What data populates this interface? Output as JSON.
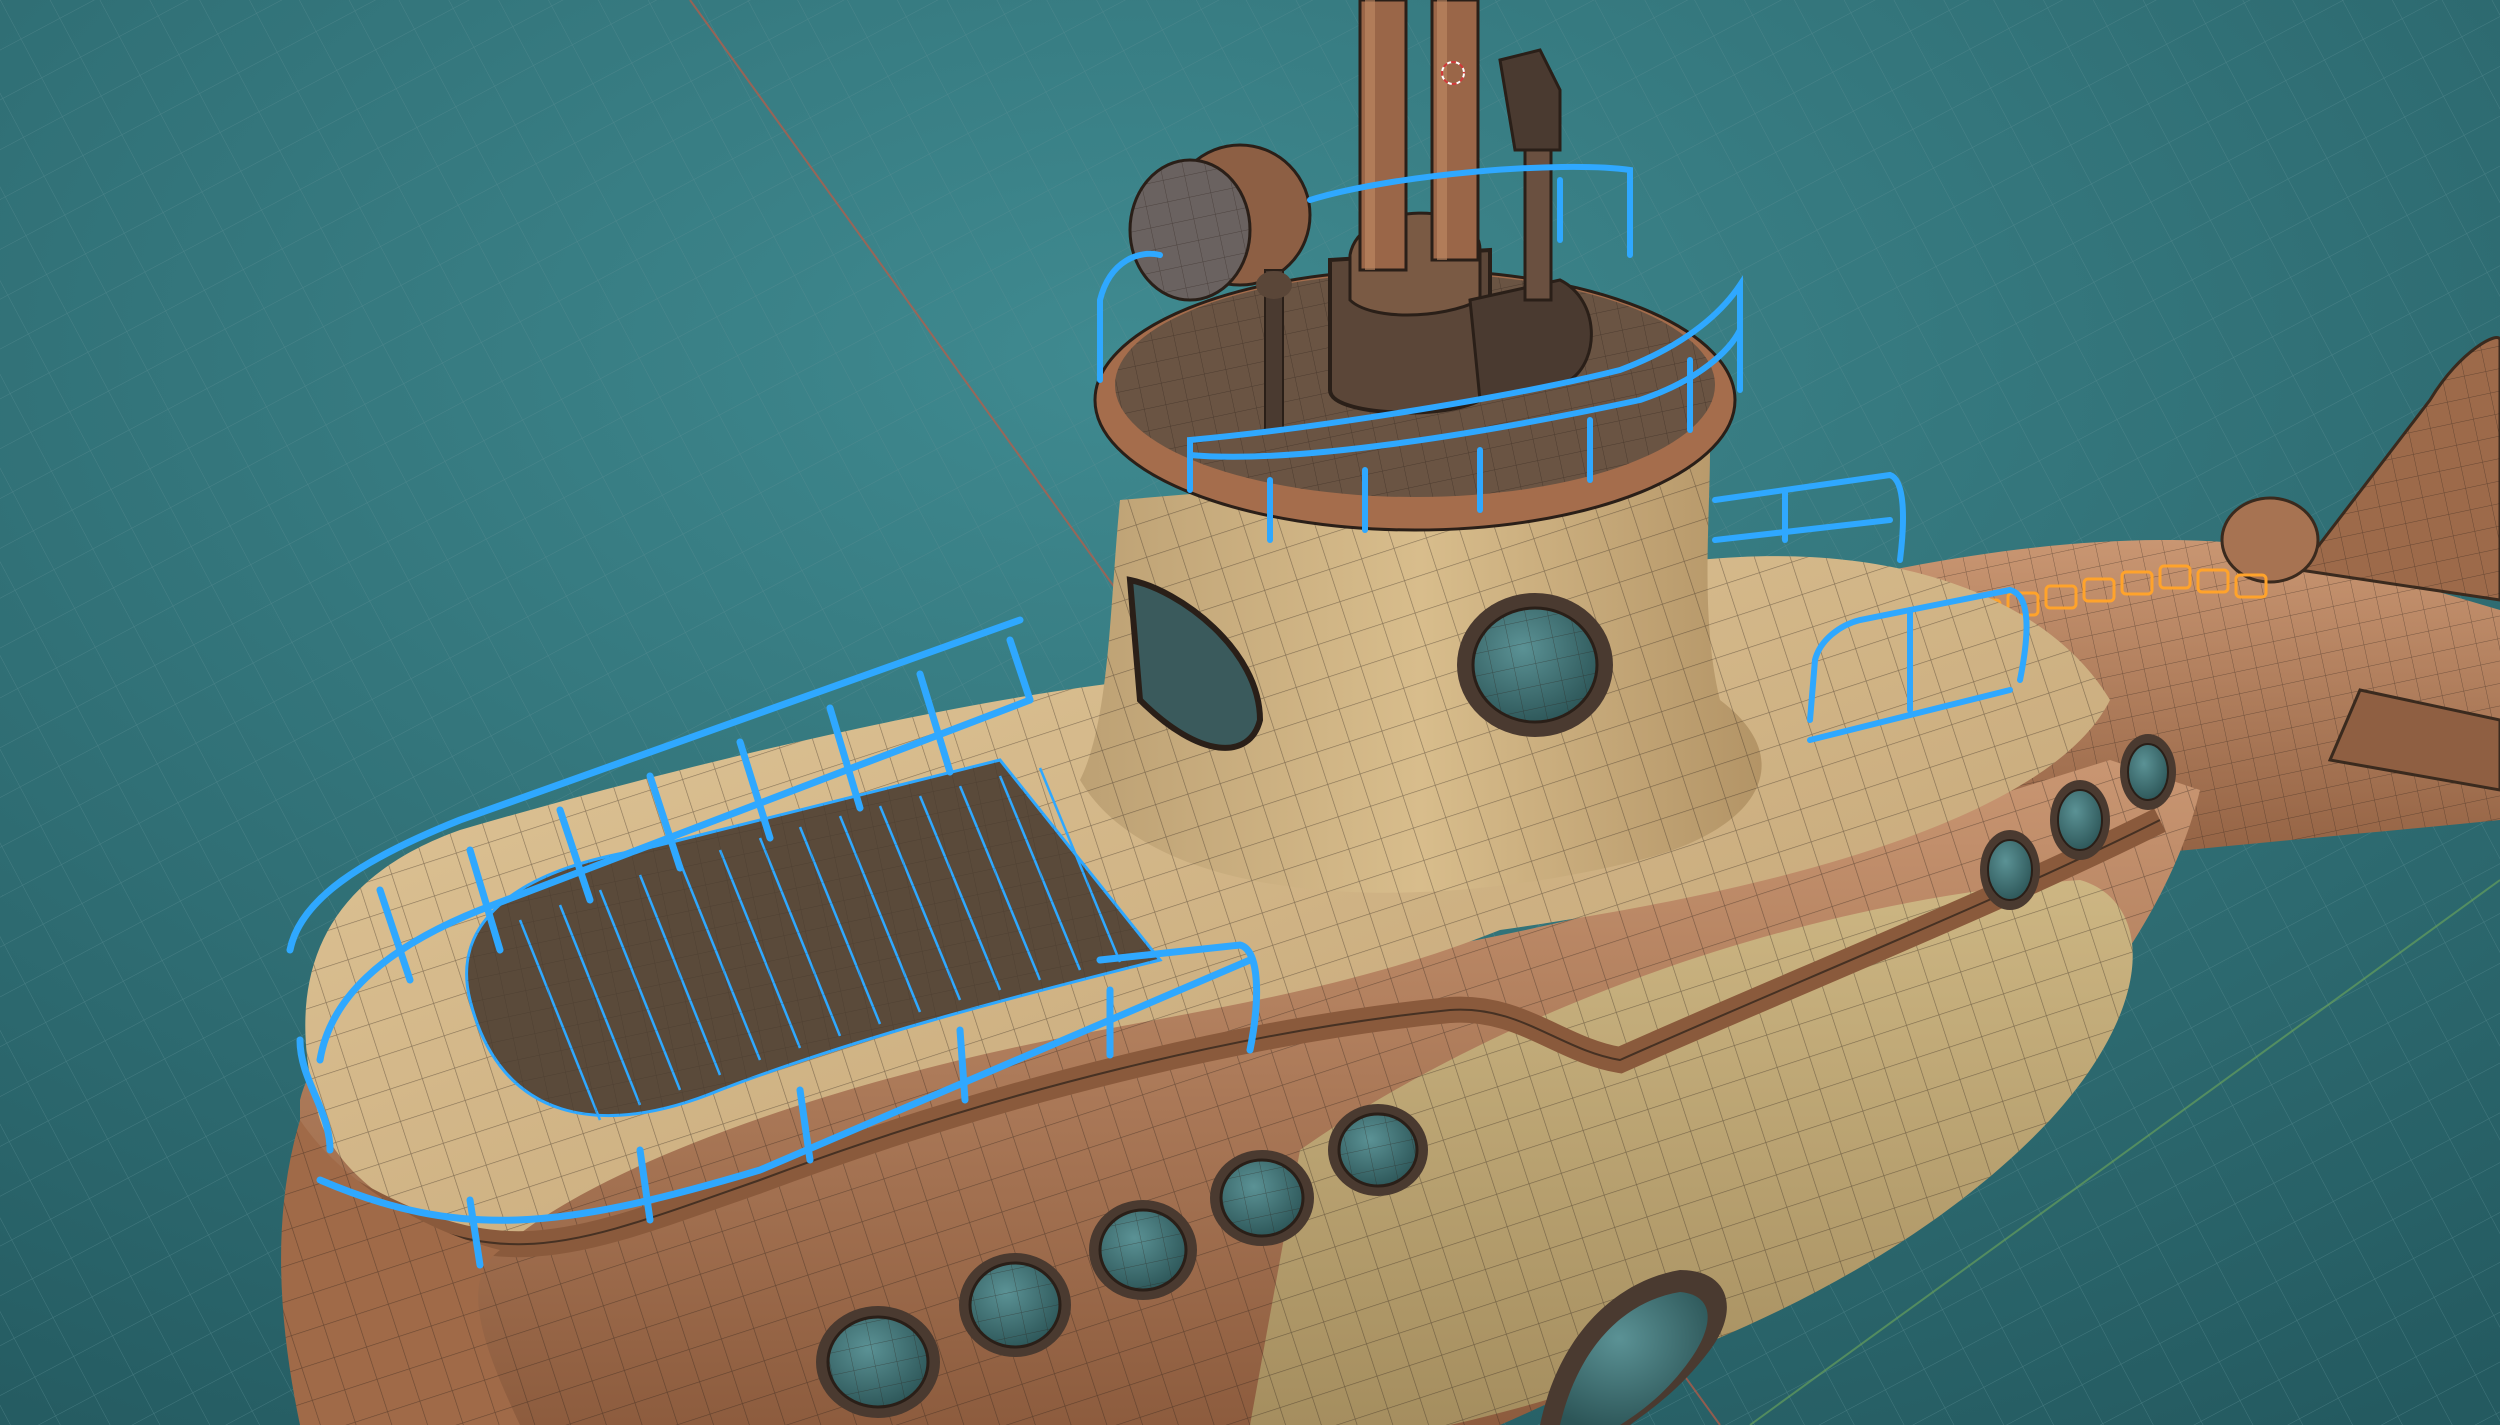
{
  "viewport": {
    "background": "#2b6a70",
    "grid_color": "#5b8e93",
    "x_axis_color": "#c05a44",
    "y_axis_color": "#6fa85a"
  },
  "model": {
    "subject": "submarine",
    "hull_color": "#b07a55",
    "deck_color": "#d6b889",
    "wireframe_color": "#2a1f18",
    "selection_color": "#2fa8ff",
    "active_selection_color": "#ffa32b",
    "porthole_glass_color": "#3c6d70"
  },
  "icons": {
    "cursor": "3d-cursor-icon"
  }
}
